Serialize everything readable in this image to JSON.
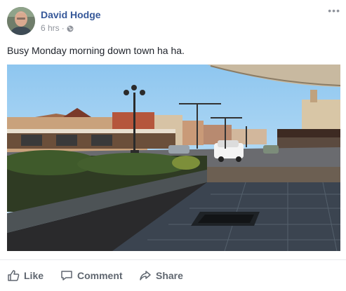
{
  "post": {
    "author": "David Hodge",
    "time": "6 hrs",
    "separator": "·",
    "caption": "Busy Monday morning down town ha ha.",
    "more_icon": "•••"
  },
  "photo": {
    "alt": "street-scene"
  },
  "actions": {
    "like": "Like",
    "comment": "Comment",
    "share": "Share"
  },
  "colors": {
    "name": "#365899",
    "meta": "#90949c",
    "action": "#606770"
  }
}
